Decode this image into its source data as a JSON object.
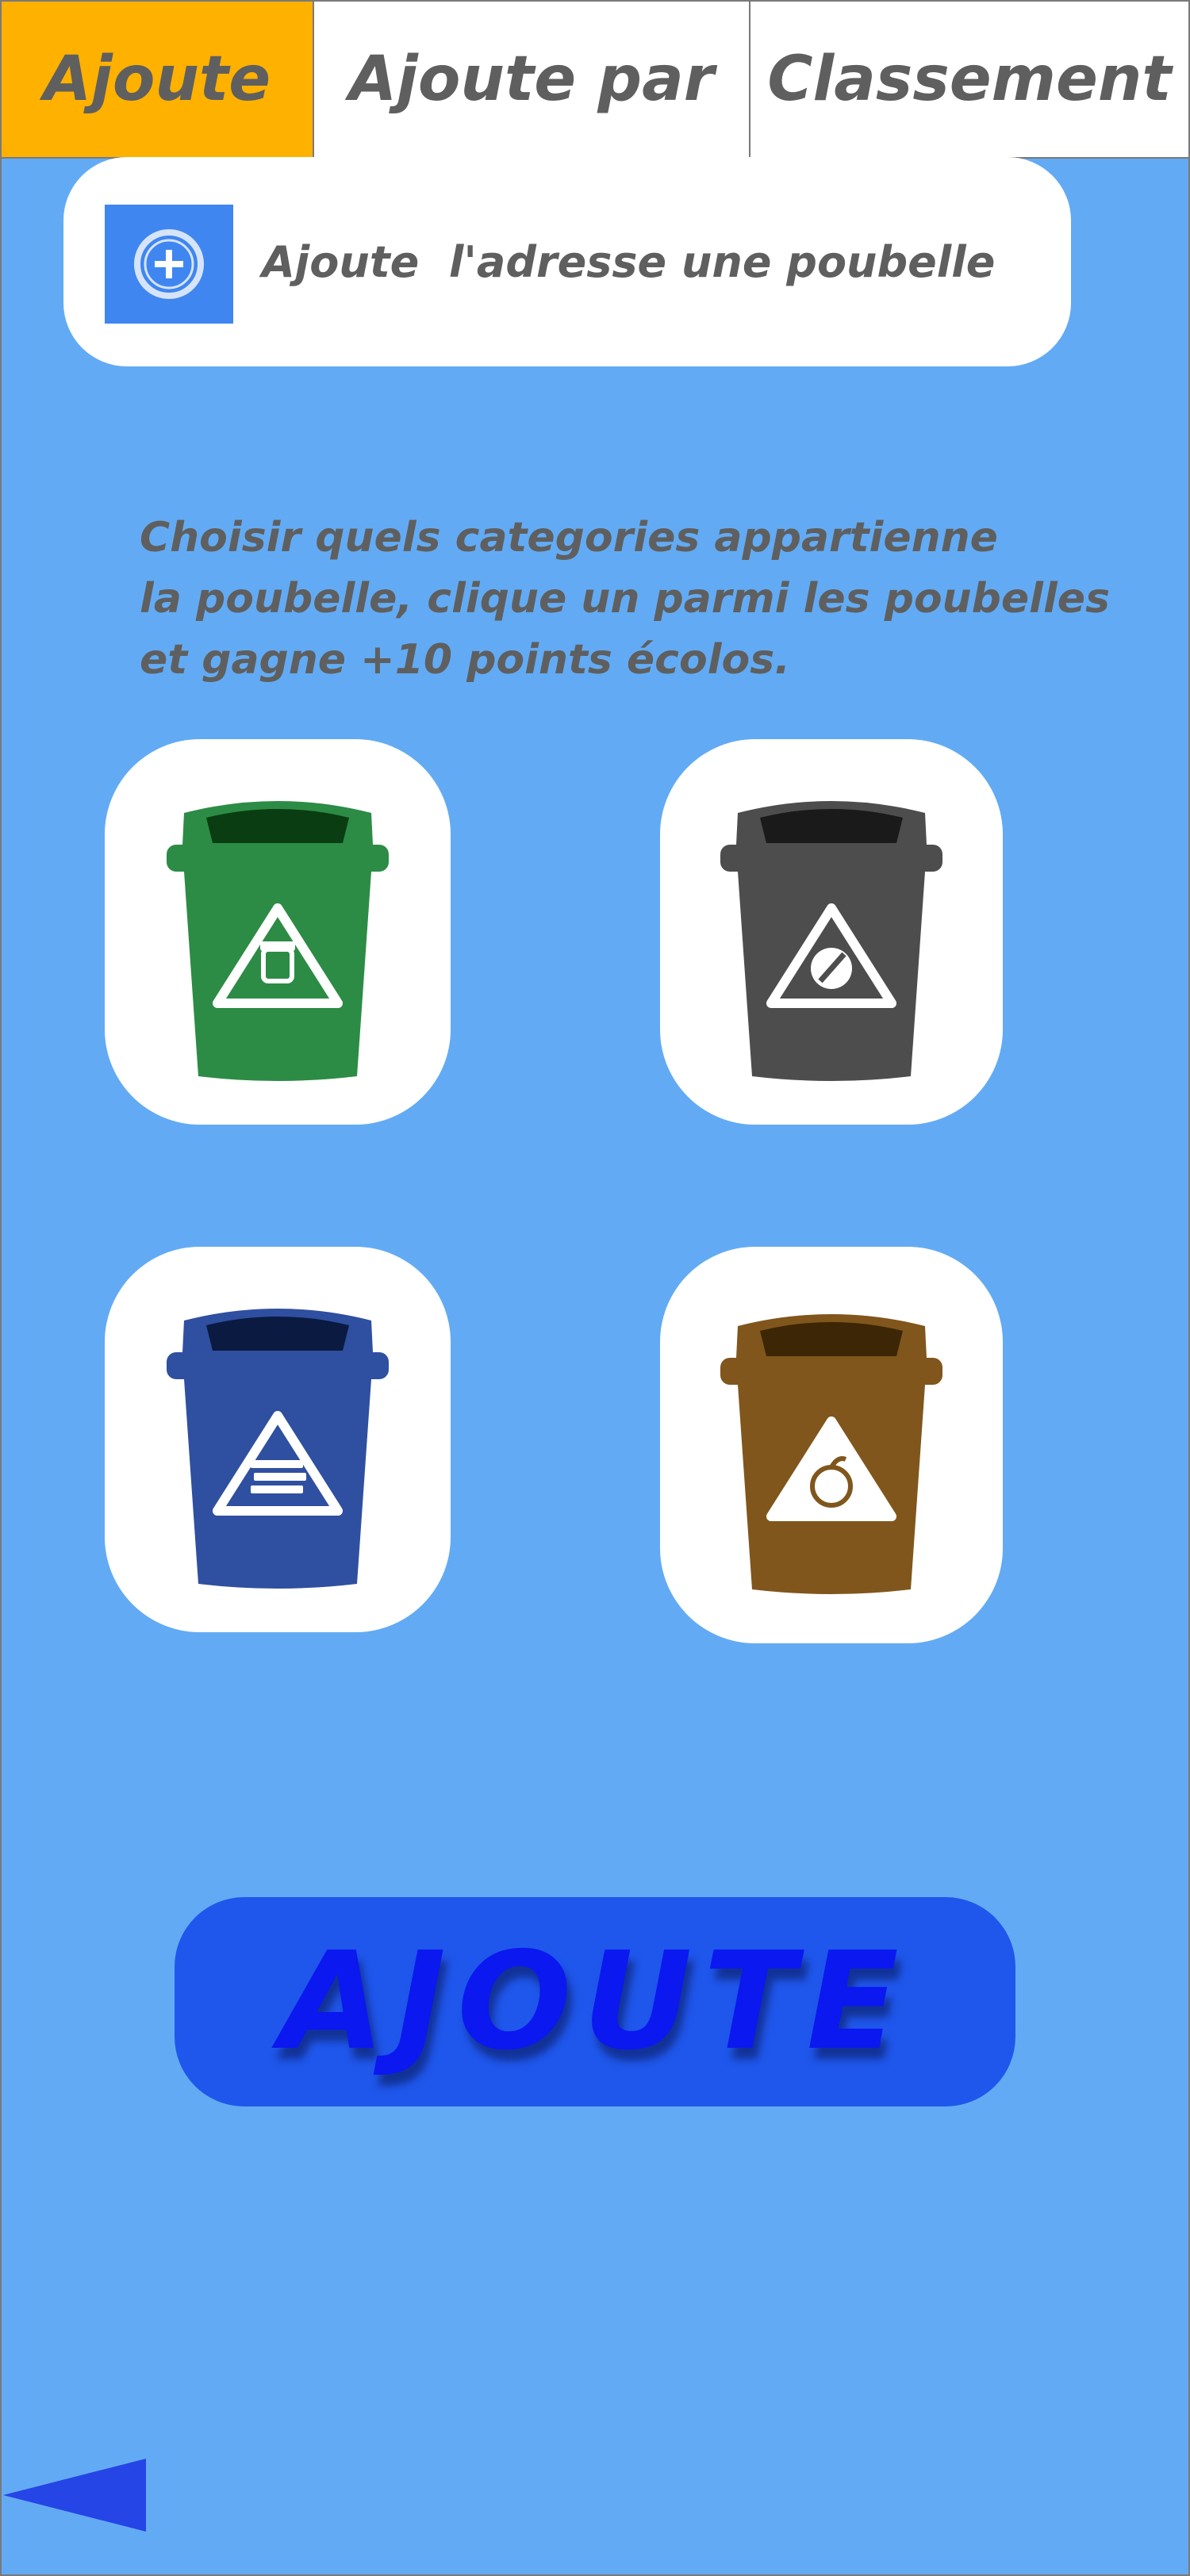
{
  "tabs": [
    {
      "label": "Ajoute"
    },
    {
      "label": "Ajoute par"
    },
    {
      "label": "Classement"
    }
  ],
  "address": {
    "label": "Ajoute  l'adresse une poubelle",
    "icon": "add-circle-icon"
  },
  "instructions": {
    "lines": [
      "Choisir quels categories appartienne",
      "la poubelle, clique un parmi les poubelles",
      "et gagne +10 points écolos."
    ]
  },
  "bins": [
    {
      "color": "#2c8c45",
      "lid": "#0a3d12",
      "symbol": "jar-icon"
    },
    {
      "color": "#4d4d4d",
      "lid": "#1a1a1a",
      "symbol": "glass-icon"
    },
    {
      "color": "#2f4fa0",
      "lid": "#0b1a40",
      "symbol": "paper-icon"
    },
    {
      "color": "#80561c",
      "lid": "#3d2605",
      "symbol": "organic-icon"
    }
  ],
  "submit": {
    "label": "AJOUTE"
  },
  "colors": {
    "background": "#62abf4",
    "active_tab": "#ffb100",
    "submit_bg": "#1f57ec",
    "back_arrow": "#2545e6"
  }
}
